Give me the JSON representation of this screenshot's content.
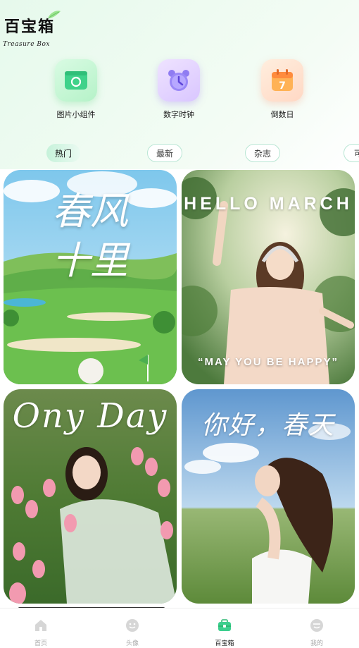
{
  "header": {
    "title": "百宝箱",
    "subtitle": "Treasure Box"
  },
  "tools": [
    {
      "label": "图片小组件",
      "icon": "photo-widget-icon"
    },
    {
      "label": "数字时钟",
      "icon": "alarm-clock-icon"
    },
    {
      "label": "倒数日",
      "icon": "calendar-countdown-icon",
      "day": "7"
    }
  ],
  "tabs": [
    {
      "label": "热门",
      "active": true
    },
    {
      "label": "最新",
      "active": false
    },
    {
      "label": "杂志",
      "active": false
    },
    {
      "label": "可",
      "active": false
    }
  ],
  "cards": [
    {
      "title_line1": "春风",
      "title_line2": "十里"
    },
    {
      "title": "HELLO MARCH",
      "subtitle": "“MAY YOU BE HAPPY”"
    },
    {
      "title": "Ony Day"
    },
    {
      "title": "你好，春天"
    }
  ],
  "tabbar": [
    {
      "label": "首页",
      "icon": "home-icon",
      "active": false
    },
    {
      "label": "头像",
      "icon": "smiley-face-icon",
      "active": false
    },
    {
      "label": "百宝箱",
      "icon": "toolbox-icon",
      "active": true
    },
    {
      "label": "我的",
      "icon": "profile-face-icon",
      "active": false
    }
  ],
  "colors": {
    "accent": "#3ccf8e",
    "tab_border": "#b9e6d4",
    "header_bg": "#e6f9ec"
  }
}
